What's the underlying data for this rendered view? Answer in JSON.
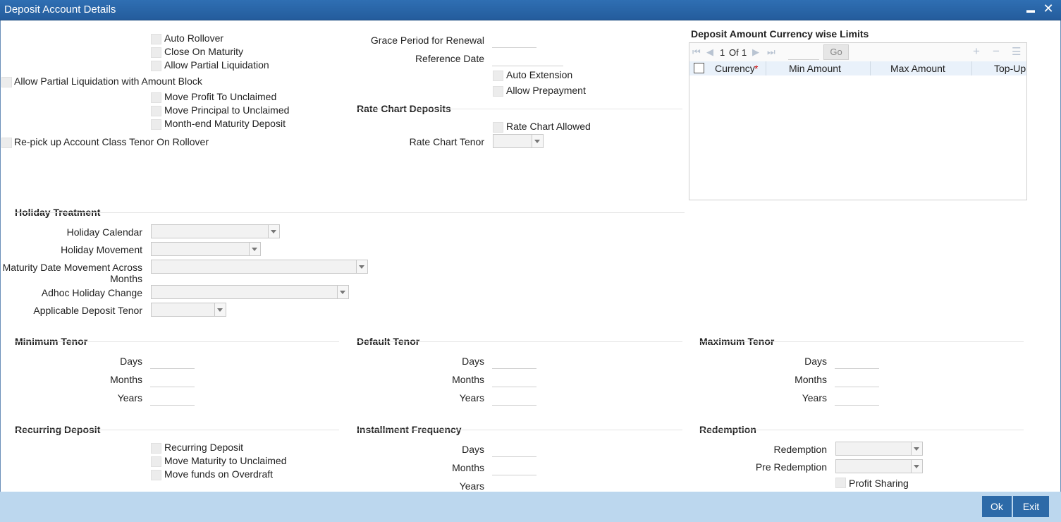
{
  "window": {
    "title": "Deposit Account Details",
    "minimize_label": "▬",
    "close_label": "✕"
  },
  "flags": {
    "auto_rollover": "Auto Rollover",
    "close_on_maturity": "Close On Maturity",
    "allow_partial_liquidation": "Allow Partial Liquidation",
    "allow_partial_liquidation_amount_block": "Allow Partial Liquidation with Amount Block",
    "move_profit_to_unclaimed": "Move Profit To Unclaimed",
    "move_principal_to_unclaimed": "Move Principal to Unclaimed",
    "month_end_maturity_deposit": "Month-end Maturity Deposit",
    "repick_account_class_tenor": "Re-pick up Account Class Tenor On Rollover"
  },
  "renewal": {
    "grace_period_label": "Grace Period for Renewal",
    "grace_period_value": "",
    "reference_date_label": "Reference Date",
    "reference_date_value": "",
    "auto_extension": "Auto Extension",
    "allow_prepayment": "Allow Prepayment"
  },
  "rate_chart": {
    "heading": "Rate Chart Deposits",
    "allowed_label": "Rate Chart Allowed",
    "tenor_label": "Rate Chart Tenor",
    "tenor_value": ""
  },
  "limits": {
    "heading": "Deposit Amount Currency wise Limits",
    "page_current": "1",
    "page_of": "Of",
    "page_total": "1",
    "go_label": "Go",
    "columns": {
      "currency": "Currency",
      "required_mark": "*",
      "min_amount": "Min Amount",
      "max_amount": "Max Amount",
      "topup": "Top-Up U"
    }
  },
  "holiday": {
    "heading": "Holiday Treatment",
    "calendar_label": "Holiday Calendar",
    "calendar_value": "",
    "movement_label": "Holiday Movement",
    "movement_value": "",
    "maturity_move_label_1": "Maturity Date Movement Across",
    "maturity_move_label_2": "Months",
    "maturity_move_value": "",
    "adhoc_label": "Adhoc Holiday Change",
    "adhoc_value": "",
    "applicable_tenor_label": "Applicable Deposit Tenor",
    "applicable_tenor_value": ""
  },
  "tenors": {
    "minimum": {
      "heading": "Minimum Tenor",
      "days": "Days",
      "months": "Months",
      "years": "Years"
    },
    "default": {
      "heading": "Default Tenor",
      "days": "Days",
      "months": "Months",
      "years": "Years"
    },
    "maximum": {
      "heading": "Maximum Tenor",
      "days": "Days",
      "months": "Months",
      "years": "Years"
    }
  },
  "recurring": {
    "heading": "Recurring Deposit",
    "recurring_deposit": "Recurring Deposit",
    "move_maturity_unclaimed": "Move Maturity to Unclaimed",
    "move_funds_overdraft": "Move funds on Overdraft"
  },
  "installment": {
    "heading": "Installment Frequency",
    "days": "Days",
    "months": "Months",
    "years": "Years"
  },
  "redemption": {
    "heading": "Redemption",
    "redemption_label": "Redemption",
    "redemption_value": "",
    "pre_redemption_label": "Pre Redemption",
    "pre_redemption_value": "",
    "profit_sharing": "Profit Sharing"
  },
  "footer": {
    "ok_label": "Ok",
    "exit_label": "Exit"
  }
}
